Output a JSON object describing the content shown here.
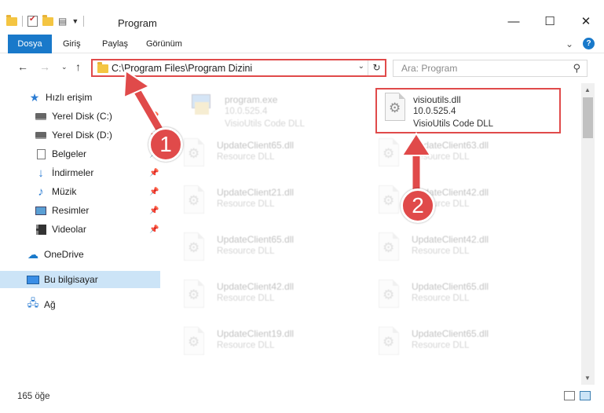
{
  "window": {
    "title": "Program",
    "controls": {
      "minimize": "—",
      "maximize": "☐",
      "close": "✕"
    }
  },
  "ribbon": {
    "tabs": [
      "Dosya",
      "Giriş",
      "Paylaş",
      "Görünüm"
    ],
    "help": "?"
  },
  "address": {
    "path": "C:\\Program Files\\Program Dizini"
  },
  "search": {
    "placeholder": "Ara: Program"
  },
  "sidebar": {
    "items": [
      {
        "label": "Hızlı erişim",
        "icon": "star-icon"
      },
      {
        "label": "Yerel Disk (C:)",
        "icon": "drive-icon"
      },
      {
        "label": "Yerel Disk (D:)",
        "icon": "drive-icon"
      },
      {
        "label": "Belgeler",
        "icon": "documents-icon"
      },
      {
        "label": "İndirmeler",
        "icon": "downloads-icon"
      },
      {
        "label": "Müzik",
        "icon": "music-icon"
      },
      {
        "label": "Resimler",
        "icon": "pictures-icon"
      },
      {
        "label": "Videolar",
        "icon": "videos-icon"
      },
      {
        "label": "OneDrive",
        "icon": "cloud-icon"
      },
      {
        "label": "Bu bilgisayar",
        "icon": "computer-icon"
      },
      {
        "label": "Ağ",
        "icon": "network-icon"
      }
    ]
  },
  "files": [
    {
      "name": "program.exe",
      "line2": "10.0.525.4",
      "line3": "VisioUtils Code DLL"
    },
    {
      "name": "visioutils.dll",
      "line2": "10.0.525.4",
      "line3": "VisioUtils Code DLL"
    },
    {
      "name": "UpdateClient65.dll",
      "line2": "Resource DLL"
    },
    {
      "name": "UpdateClient63.dll",
      "line2": "Resource DLL"
    },
    {
      "name": "UpdateClient21.dll",
      "line2": "Resource DLL"
    },
    {
      "name": "UpdateClient42.dll",
      "line2": "Resource DLL"
    },
    {
      "name": "UpdateClient65.dll",
      "line2": "Resource DLL"
    },
    {
      "name": "UpdateClient42.dll",
      "line2": "Resource DLL"
    },
    {
      "name": "UpdateClient42.dll",
      "line2": "Resource DLL"
    },
    {
      "name": "UpdateClient65.dll",
      "line2": "Resource DLL"
    },
    {
      "name": "UpdateClient19.dll",
      "line2": "Resource DLL"
    },
    {
      "name": "UpdateClient65.dll",
      "line2": "Resource DLL"
    }
  ],
  "status": {
    "count": "165 öğe"
  },
  "annotations": {
    "step1": "1",
    "step2": "2",
    "color": "#e04a4a"
  }
}
